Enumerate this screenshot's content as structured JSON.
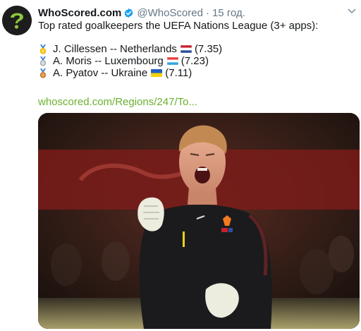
{
  "tweet": {
    "display_name": "WhoScored.com",
    "handle": "@WhoScored",
    "separator": "·",
    "time": "15 год.",
    "heading": "Top rated goalkeepers the UEFA Nations League (3+ apps):",
    "rankings": [
      {
        "player": "J. Cillessen",
        "separator": "--",
        "country": "Netherlands",
        "rating": "(7.35)",
        "medal": "gold",
        "flag": "netherlands"
      },
      {
        "player": "A. Moris",
        "separator": "--",
        "country": "Luxembourg",
        "rating": "(7.23)",
        "medal": "silver",
        "flag": "luxembourg"
      },
      {
        "player": "A. Pyatov",
        "separator": "--",
        "country": "Ukraine",
        "rating": "(7.11)",
        "medal": "bronze",
        "flag": "ukraine"
      }
    ],
    "link": "whoscored.com/Regions/247/To...",
    "colors": {
      "link": "#6bb02f",
      "verified": "#1da1f2",
      "secondary_text": "#657786",
      "logo_background": "#1d1d1d",
      "logo_mark": "#8fc43d",
      "photo_jersey": "#1b1b1d"
    },
    "icons": {
      "verified": "verified-badge-icon",
      "caret": "chevron-down-icon",
      "avatar": "whoscored-logo"
    }
  }
}
